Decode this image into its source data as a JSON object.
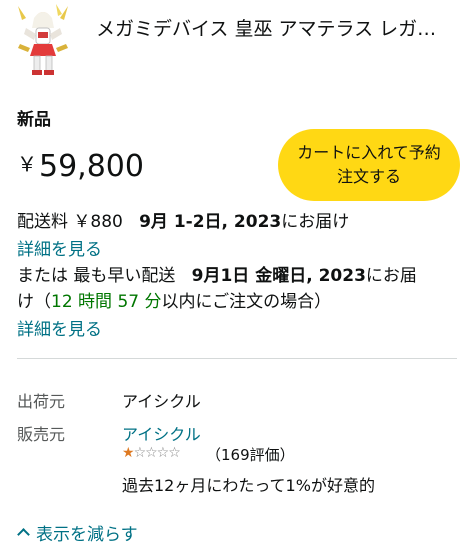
{
  "product": {
    "title": "メガミデバイス 皇巫 アマテラス レガ…",
    "condition": "新品",
    "price_currency": "￥",
    "price_amount": "59,800",
    "add_to_cart_line1": "カートに入れて予約",
    "add_to_cart_line2": "注文する"
  },
  "delivery": {
    "shipping_fee": "配送料 ￥880",
    "standard_date": "9月 1-2日, 2023",
    "standard_suffix": "にお届け",
    "details_link_1": "詳細を見る",
    "fastest_prefix": "または 最も早い配送",
    "fastest_date": "9月1日 金曜日, 2023",
    "fastest_suffix": "にお届",
    "fastest_wrap": "け（",
    "countdown": "12 時間 57 分",
    "countdown_suffix": "以内にご注文の場合）",
    "details_link_2": "詳細を見る"
  },
  "seller": {
    "ships_from_label": "出荷元",
    "ships_from_value": "アイシクル",
    "sold_by_label": "販売元",
    "sold_by_value": "アイシクル",
    "stars_rating": 1,
    "stars_max": 5,
    "stars_full": "★",
    "stars_empty": "☆☆☆☆",
    "rating_count": "（169評価）",
    "positive_text": "過去12ヶ月にわたって1%が好意的"
  },
  "footer": {
    "show_less": "表示を減らす"
  },
  "colors": {
    "cart_button": "#ffd814",
    "link": "#007185",
    "countdown": "#007600",
    "star": "#de7921"
  }
}
